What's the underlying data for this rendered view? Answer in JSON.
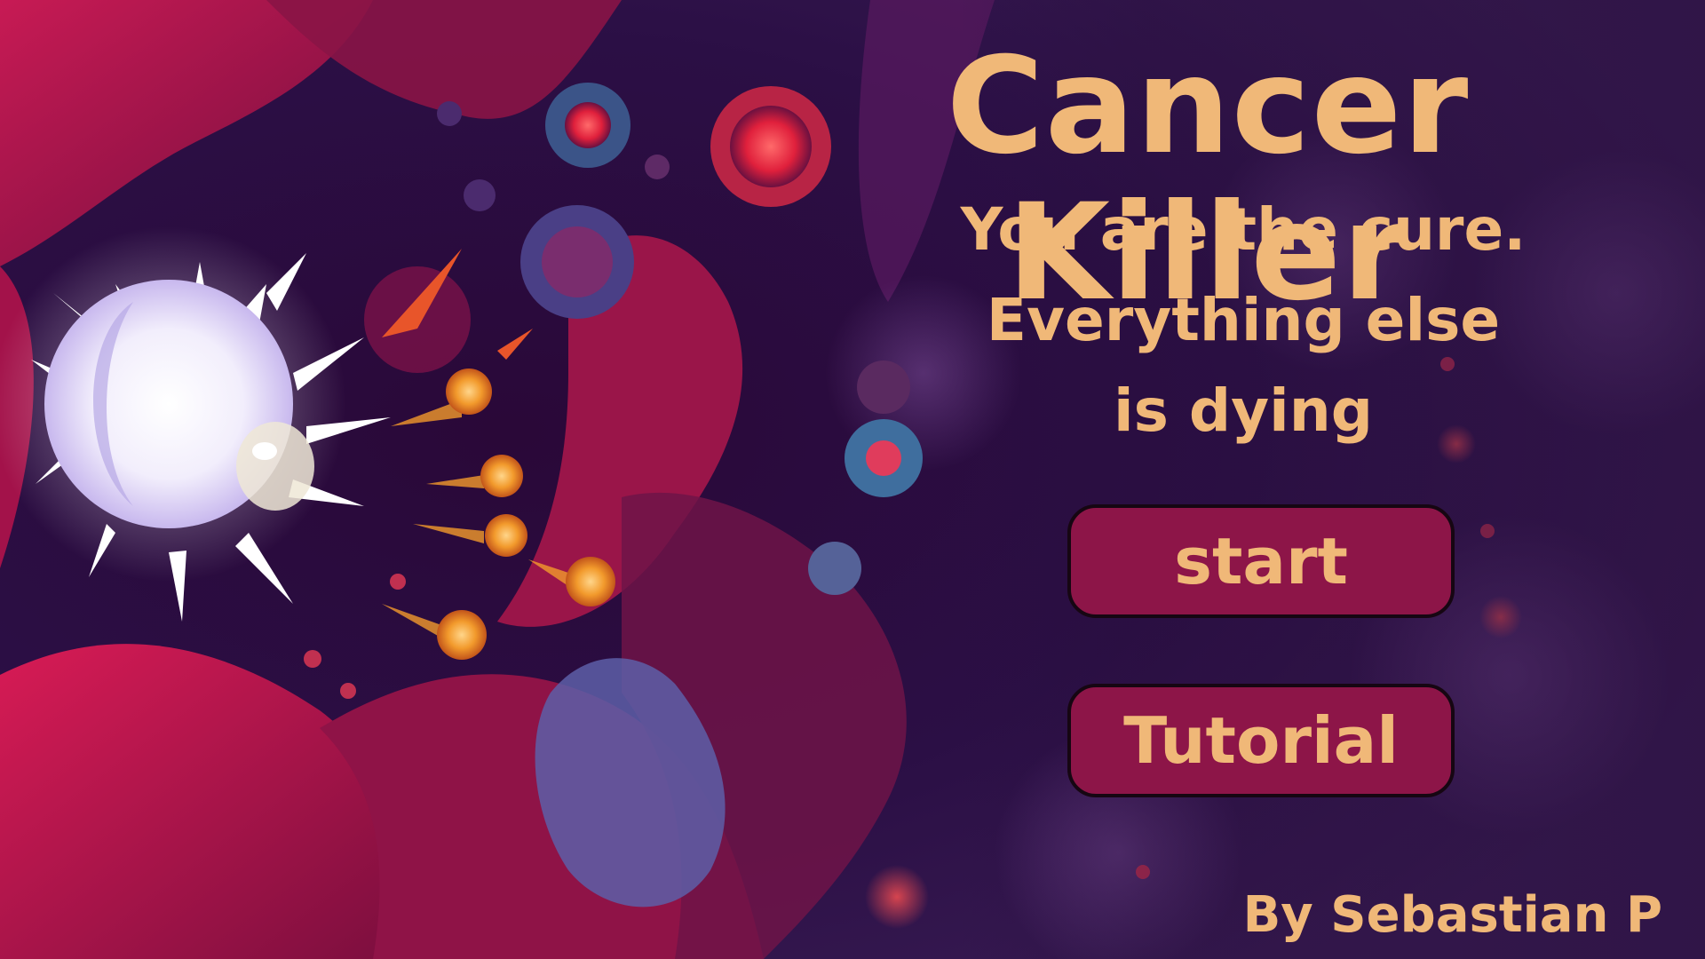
{
  "title": "Cancer Killer",
  "tagline": {
    "line1": "You are the cure.",
    "line2": "Everything else",
    "line3": "is dying"
  },
  "menu": {
    "start_label": "start",
    "tutorial_label": "Tutorial"
  },
  "credit": "By Sebastian P",
  "colors": {
    "text_gold": "#f0b878",
    "button_fill": "#8d1548",
    "button_border": "#160612",
    "background": "#1c0a2e",
    "tissue_red": "#c0154a"
  }
}
